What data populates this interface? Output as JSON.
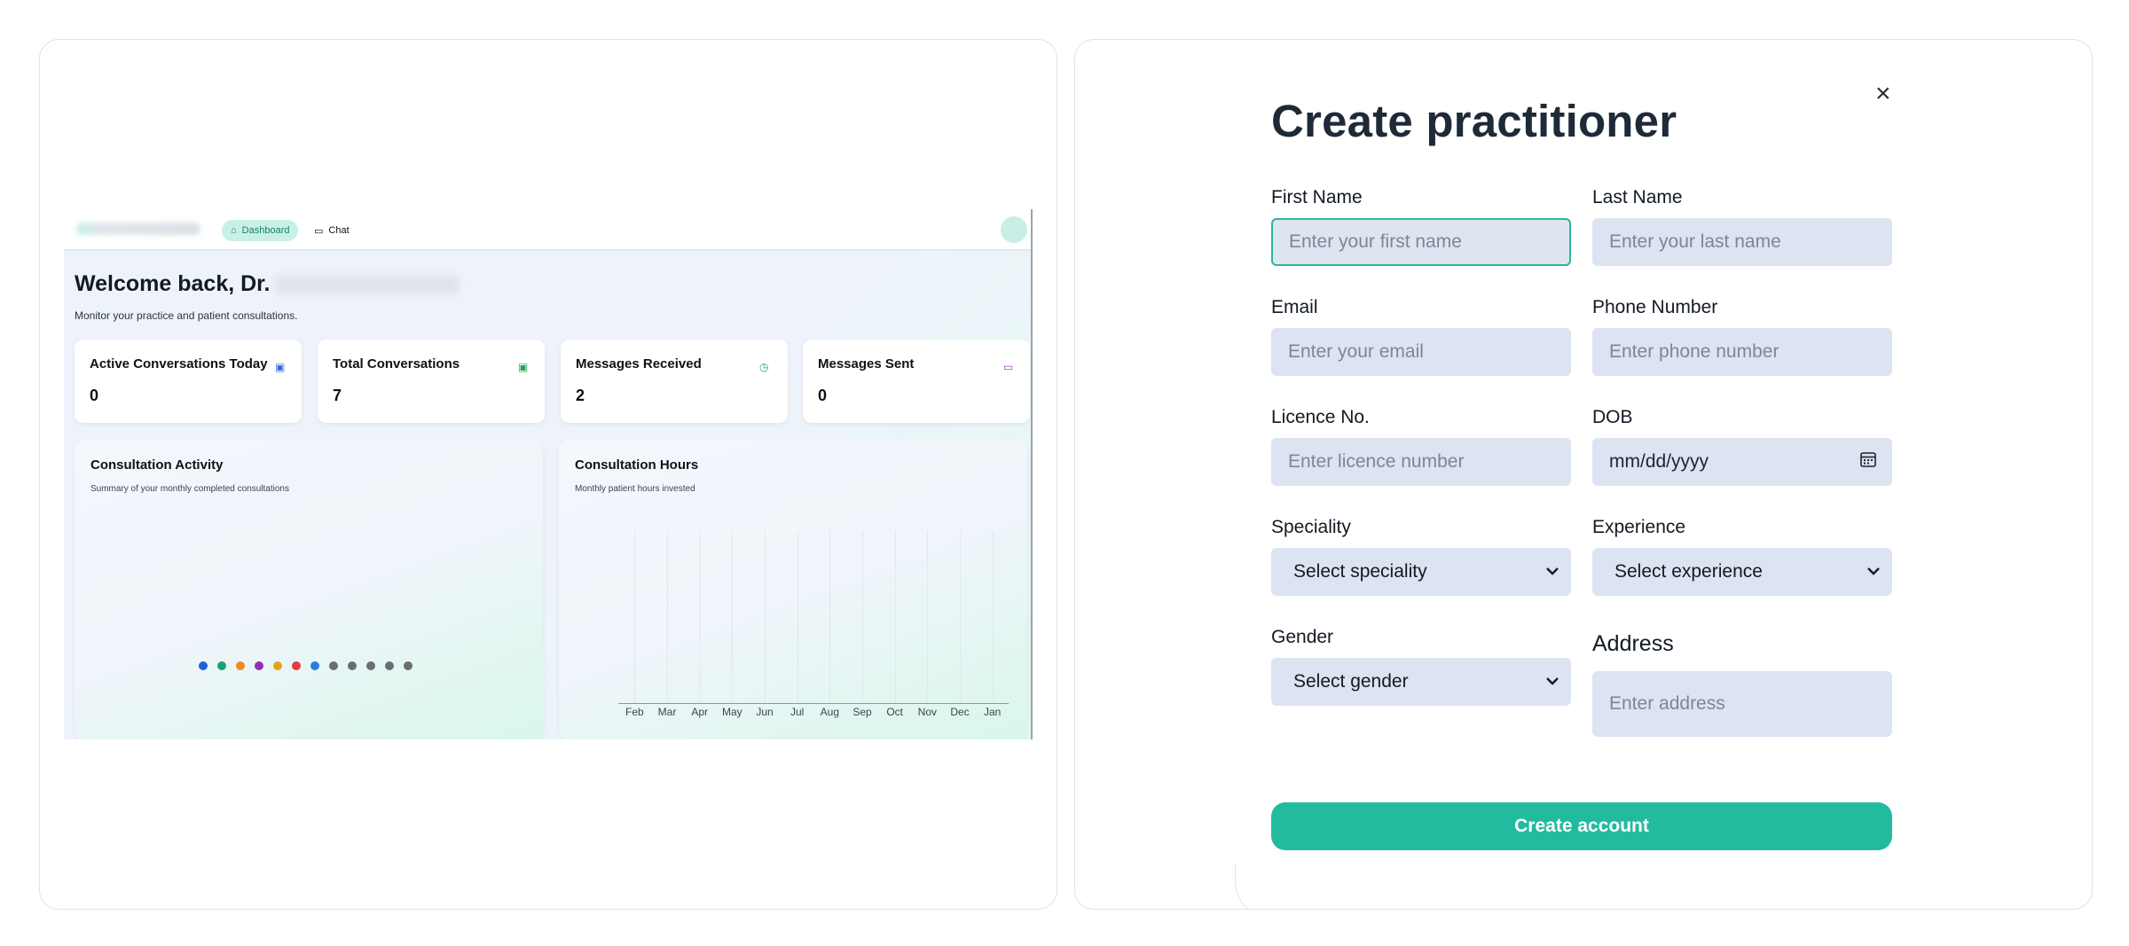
{
  "dashboard": {
    "nav": {
      "dashboard_label": "Dashboard",
      "chat_label": "Chat"
    },
    "welcome_prefix": "Welcome back, Dr.",
    "subtitle": "Monitor your practice and patient consultations.",
    "stats": [
      {
        "title": "Active Conversations Today",
        "value": "0",
        "icon": "calendar-icon",
        "color": "#2f6fe4"
      },
      {
        "title": "Total Conversations",
        "value": "7",
        "icon": "calendar-icon",
        "color": "#22a55a"
      },
      {
        "title": "Messages Received",
        "value": "2",
        "icon": "clock-icon",
        "color": "#22a55a"
      },
      {
        "title": "Messages Sent",
        "value": "0",
        "icon": "message-icon",
        "color": "#b03ad6"
      }
    ],
    "activity_card": {
      "title": "Consultation Activity",
      "subtitle": "Summary of your monthly completed consultations",
      "dot_colors": [
        "#1e63d6",
        "#1aa36f",
        "#f08a24",
        "#8e2fb5",
        "#e7a21c",
        "#e23c3c",
        "#2a7de1",
        "#6d6d6d",
        "#6d6d6d",
        "#6d6d6d",
        "#6d6d6d",
        "#6d6d6d"
      ]
    },
    "hours_card": {
      "title": "Consultation Hours",
      "subtitle": "Monthly patient hours invested",
      "months": [
        "Feb",
        "Mar",
        "Apr",
        "May",
        "Jun",
        "Jul",
        "Aug",
        "Sep",
        "Oct",
        "Nov",
        "Dec",
        "Jan"
      ]
    }
  },
  "form": {
    "title": "Create practitioner",
    "close_icon": "×",
    "first_name": {
      "label": "First Name",
      "placeholder": "Enter your first name"
    },
    "last_name": {
      "label": "Last Name",
      "placeholder": "Enter your last name"
    },
    "email": {
      "label": "Email",
      "placeholder": "Enter your email"
    },
    "phone": {
      "label": "Phone Number",
      "placeholder": "Enter phone number"
    },
    "licence": {
      "label": "Licence No.",
      "placeholder": "Enter licence number"
    },
    "dob": {
      "label": "DOB",
      "placeholder": "mm/dd/yyyy"
    },
    "speciality": {
      "label": "Speciality",
      "selected": "Select speciality"
    },
    "experience": {
      "label": "Experience",
      "selected": "Select experience"
    },
    "gender": {
      "label": "Gender",
      "selected": "Select gender"
    },
    "address": {
      "label": "Address",
      "placeholder": "Enter address"
    },
    "submit_label": "Create account",
    "accent_color": "#22bba0"
  }
}
